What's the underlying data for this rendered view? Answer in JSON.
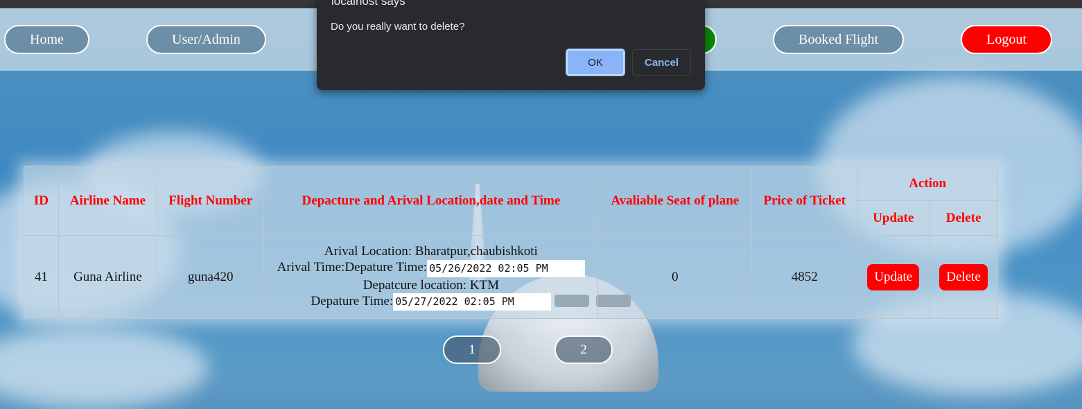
{
  "nav": {
    "home": "Home",
    "user_admin": "User/Admin",
    "booked_flight": "Booked Flight",
    "logout": "Logout"
  },
  "table": {
    "headers": {
      "id": "ID",
      "airline_name": "Airline Name",
      "flight_number": "Flight Number",
      "locations": "Depacture and Arival Location,date and Time",
      "seats": "Avaliable Seat of plane",
      "price": "Price of Ticket",
      "action": "Action",
      "update": "Update",
      "delete": "Delete"
    },
    "rows": [
      {
        "id": "41",
        "airline": "Guna Airline",
        "flight_number": "guna420",
        "arrival_location": "Arival Location: Bharatpur,chaubishkoti",
        "arrival_time_label": "Arival Time:Depature Time:",
        "arrival_time_value": "05/26/2022 02:05 PM",
        "departure_location": "Depatcure location: KTM",
        "departure_time_label": "Depature Time:",
        "departure_time_value": "05/27/2022 02:05 PM",
        "seats": "0",
        "price": "4852",
        "update_label": "Update",
        "delete_label": "Delete"
      }
    ]
  },
  "pagination": [
    "1",
    "2"
  ],
  "dialog": {
    "title": "localhost says",
    "message": "Do you really want to delete?",
    "ok": "OK",
    "cancel": "Cancel"
  },
  "colors": {
    "header_text": "#ff0000",
    "action_button": "#ff0000",
    "logout_button": "#ff0000",
    "green_button": "#0a8a0a",
    "dialog_bg": "#292a2d",
    "dialog_ok": "#8ab4f8"
  }
}
